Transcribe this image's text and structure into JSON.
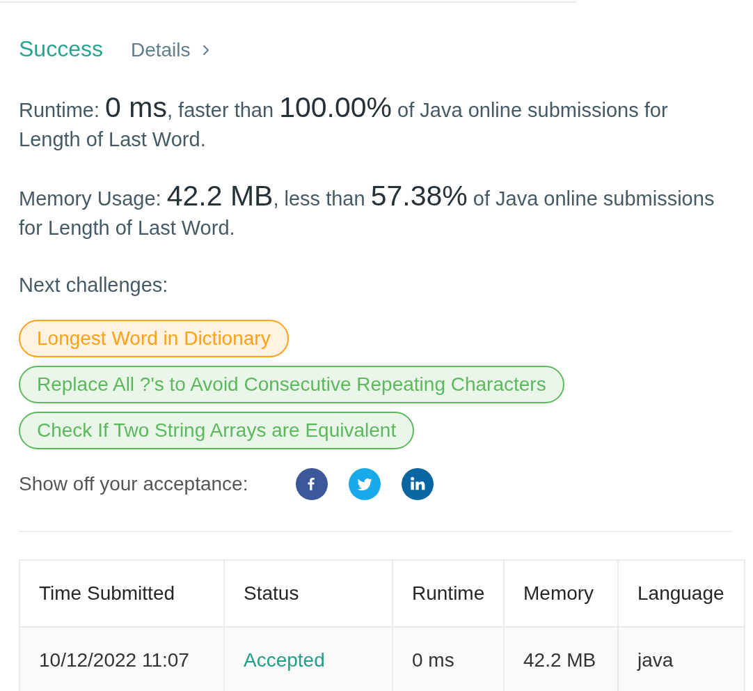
{
  "result": {
    "status": "Success",
    "details_link": "Details"
  },
  "runtime": [
    {
      "kind": "text",
      "text": "Runtime: "
    },
    {
      "kind": "figure",
      "text": "0 ms"
    },
    {
      "kind": "text",
      "text": ", faster than "
    },
    {
      "kind": "figure",
      "text": "100.00%"
    },
    {
      "kind": "text",
      "text": " of Java online submissions for Length of Last Word."
    }
  ],
  "memory": [
    {
      "kind": "text",
      "text": "Memory Usage: "
    },
    {
      "kind": "figure",
      "text": "42.2 MB"
    },
    {
      "kind": "text",
      "text": ", less than "
    },
    {
      "kind": "figure",
      "text": "57.38%"
    },
    {
      "kind": "text",
      "text": " of Java online submissions for Length of Last Word."
    }
  ],
  "next_challenges": {
    "label": "Next challenges:",
    "items": [
      {
        "title": "Longest Word in Dictionary",
        "color": "#ffa116"
      },
      {
        "title": "Replace All ?'s to Avoid Consecutive Repeating Characters",
        "color": "#5cb85c"
      },
      {
        "title": "Check If Two String Arrays are Equivalent",
        "color": "#5cb85c"
      }
    ]
  },
  "share": {
    "label": "Show off your acceptance:",
    "networks": [
      {
        "kind": "facebook"
      },
      {
        "kind": "twitter"
      },
      {
        "kind": "linkedin"
      }
    ]
  },
  "submissions": {
    "columns": [
      "Time Submitted",
      "Status",
      "Runtime",
      "Memory",
      "Language"
    ],
    "rows": [
      {
        "time_submitted": "10/12/2022 11:07",
        "status": "Accepted",
        "runtime": "0 ms",
        "memory": "42.2 MB",
        "language": "java"
      }
    ]
  }
}
